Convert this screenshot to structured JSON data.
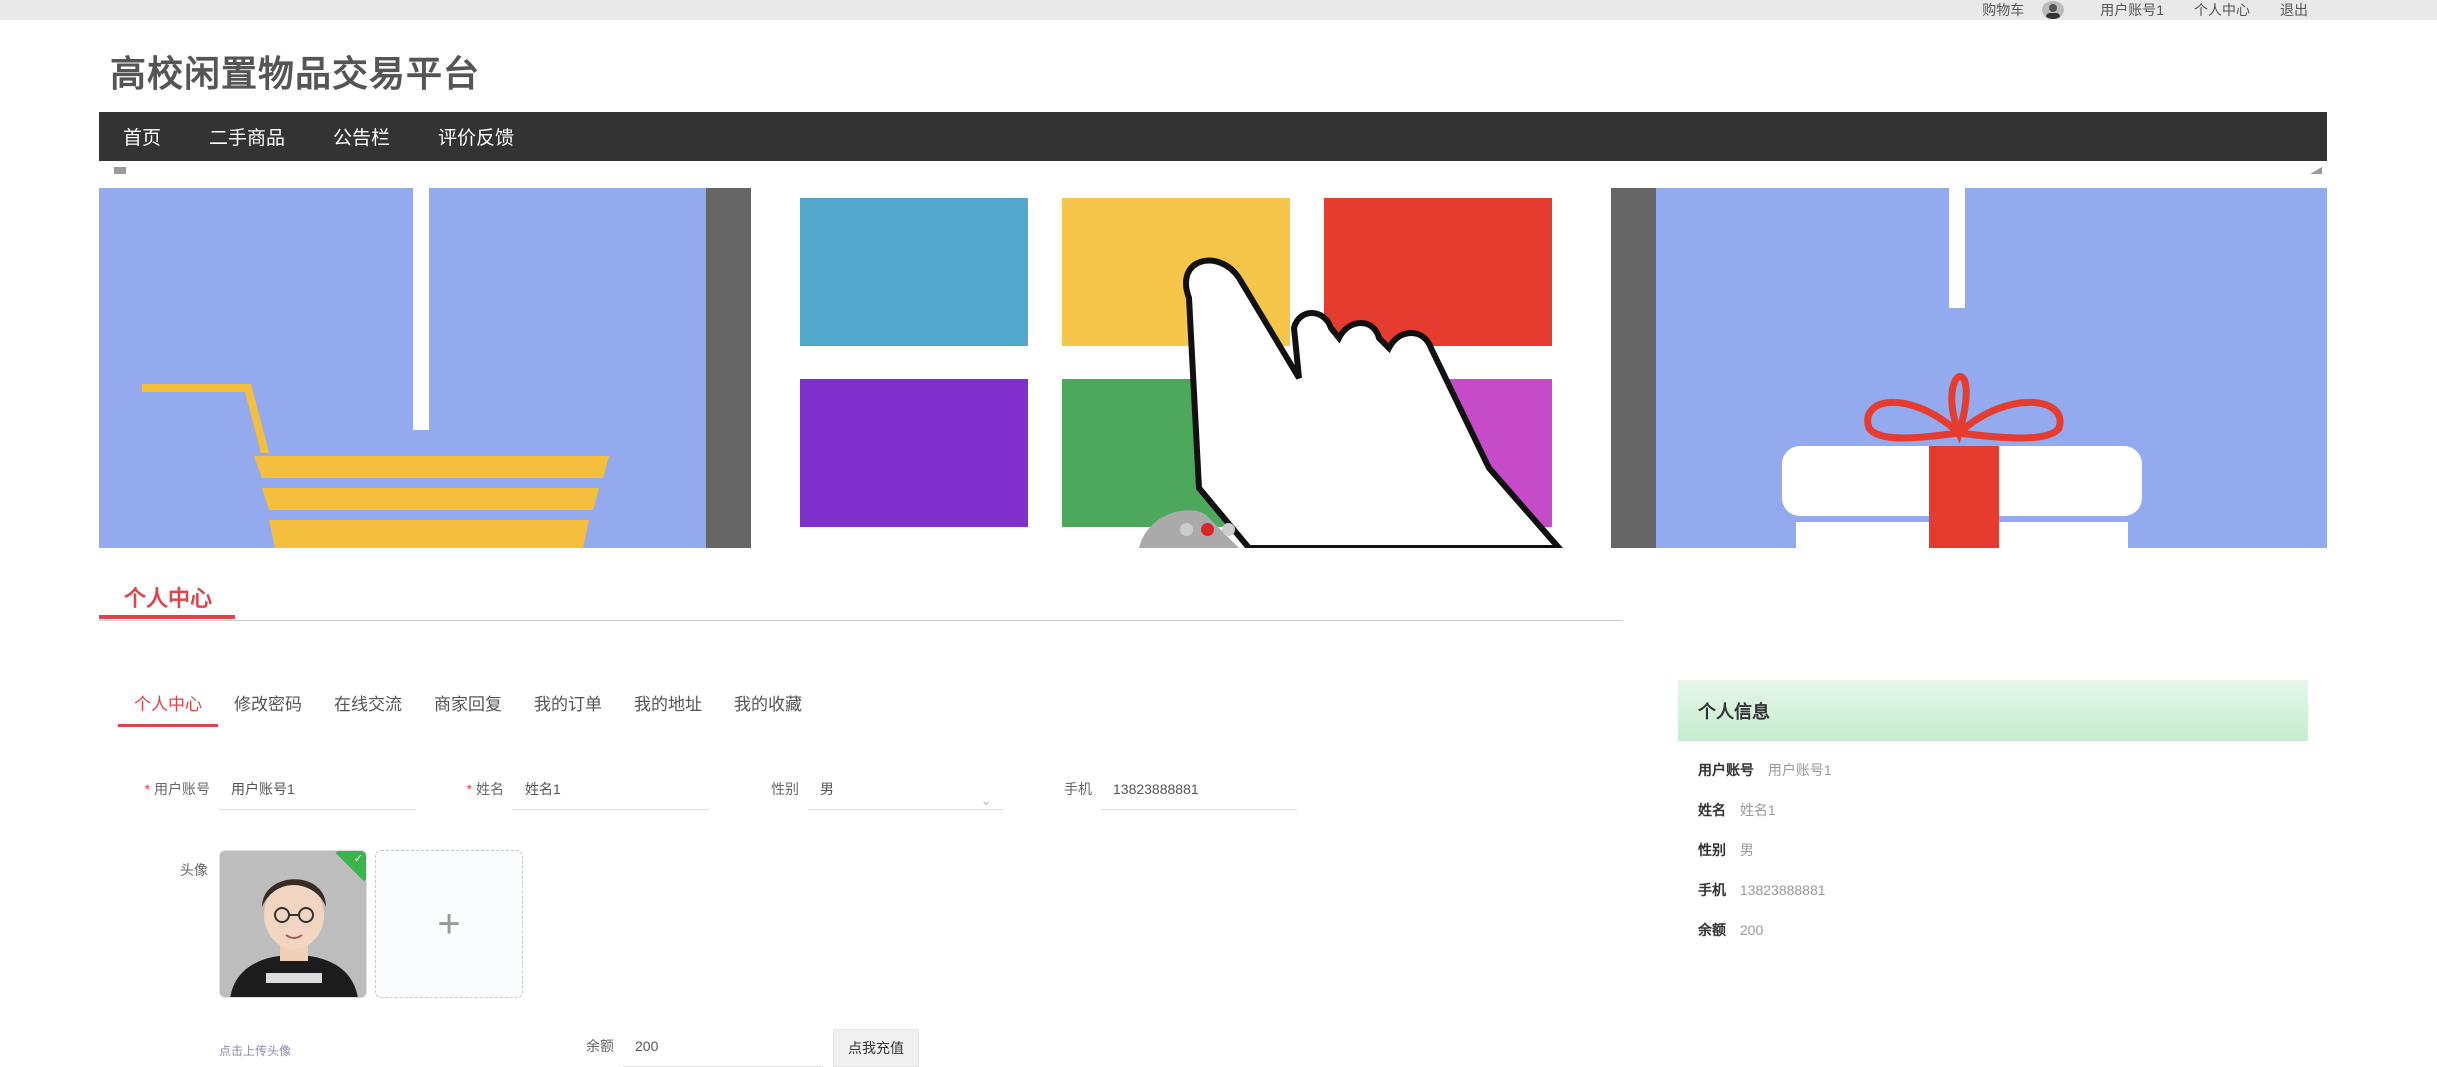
{
  "topbar": {
    "cart": "购物车",
    "username": "用户账号1",
    "personal_center": "个人中心",
    "logout": "退出"
  },
  "site": {
    "title": "高校闲置物品交易平台"
  },
  "nav": [
    "首页",
    "二手商品",
    "公告栏",
    "评价反馈"
  ],
  "banner": {
    "slide_count": 3,
    "active_index": 1
  },
  "section": {
    "title": "个人中心"
  },
  "tabs": [
    "个人中心",
    "修改密码",
    "在线交流",
    "商家回复",
    "我的订单",
    "我的地址",
    "我的收藏"
  ],
  "form": {
    "account": {
      "label": "用户账号",
      "value": "用户账号1"
    },
    "name": {
      "label": "姓名",
      "value": "姓名1"
    },
    "gender": {
      "label": "性别",
      "value": "男"
    },
    "phone": {
      "label": "手机",
      "value": "13823888881"
    },
    "avatar": {
      "label": "头像",
      "upload_hint": "点击上传头像"
    },
    "balance": {
      "label": "余额",
      "value": "200"
    },
    "recharge_button": "点我充值"
  },
  "info": {
    "title": "个人信息",
    "rows": [
      {
        "k": "用户账号",
        "v": "用户账号1"
      },
      {
        "k": "姓名",
        "v": "姓名1"
      },
      {
        "k": "性别",
        "v": "男"
      },
      {
        "k": "手机",
        "v": "13823888881"
      },
      {
        "k": "余额",
        "v": "200"
      }
    ]
  },
  "colors": {
    "accent": "#e0434b",
    "nav_bg": "#333333",
    "banner_bg": "#93aaee",
    "card_header": "#c6ecd0"
  }
}
